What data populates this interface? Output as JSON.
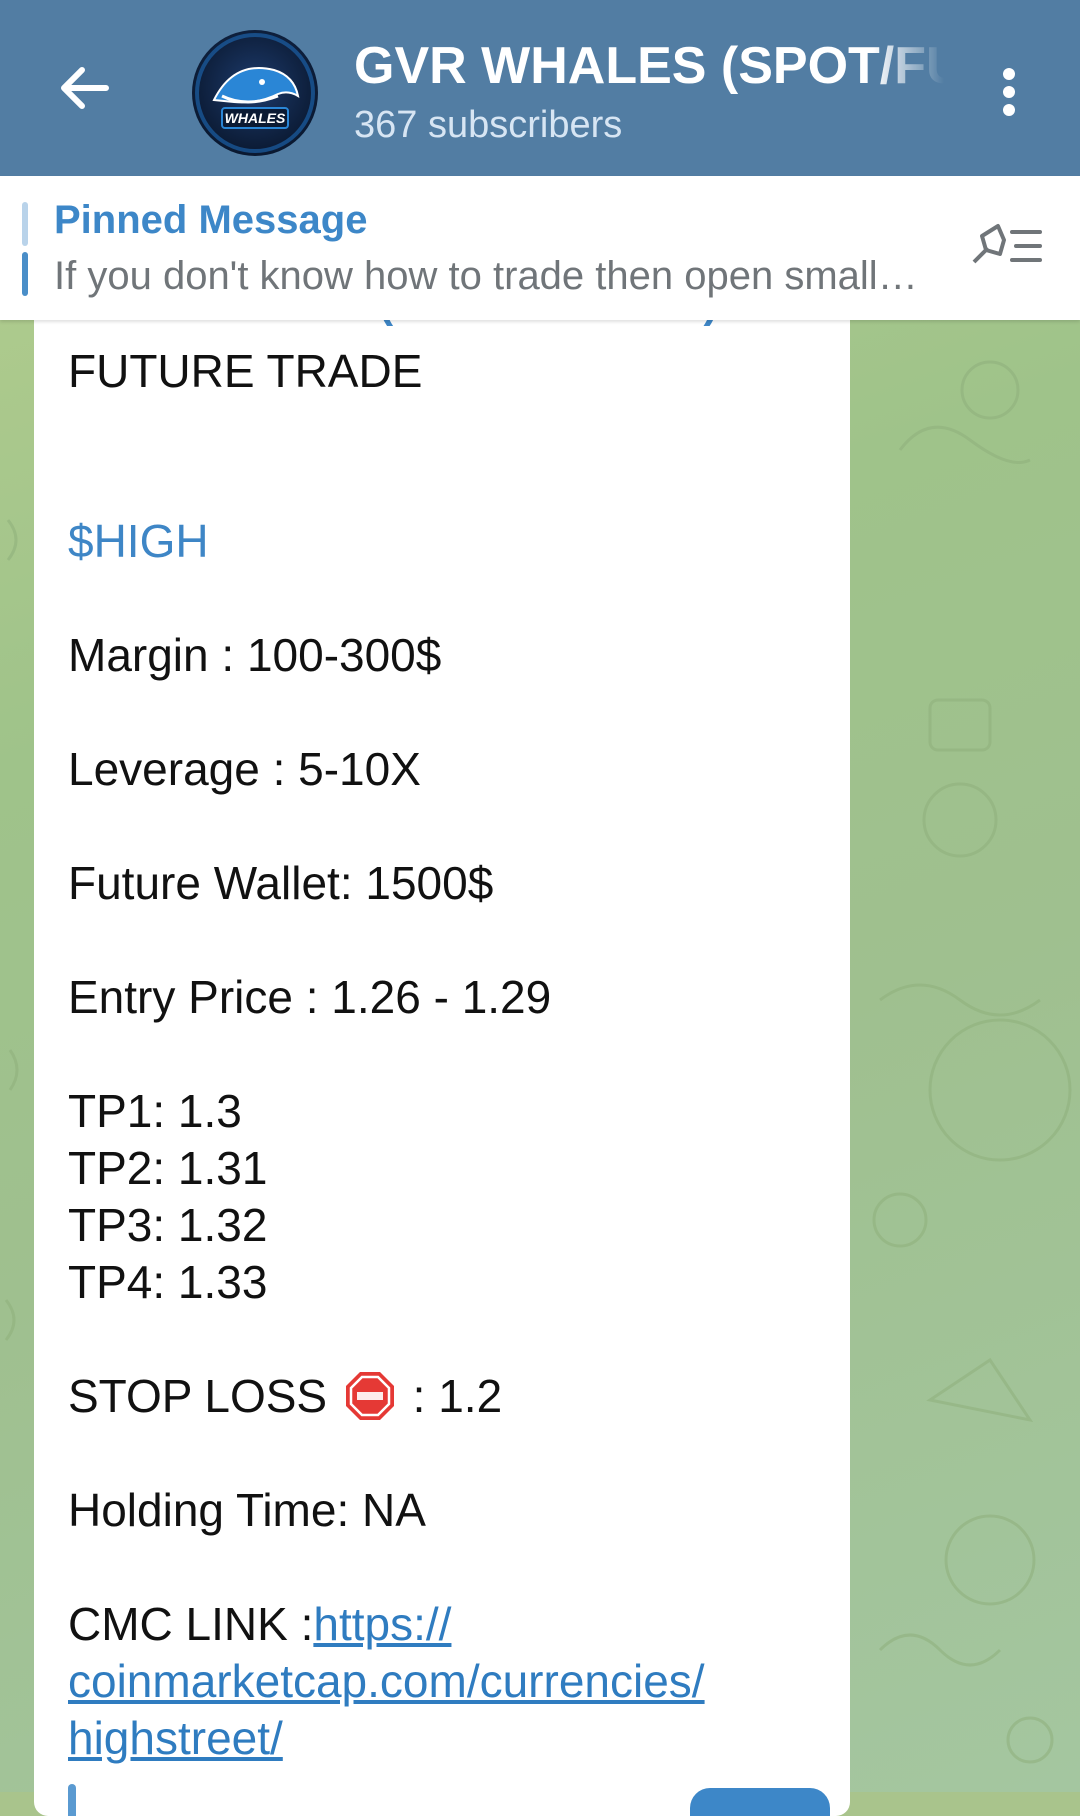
{
  "header": {
    "title": "GVR WHALES (SPOT/FUTURE)",
    "subscribers": "367 subscribers",
    "avatar_text": "WHALES"
  },
  "pinned": {
    "title": "Pinned Message",
    "text": "If you don't know how to trade then open small…"
  },
  "message": {
    "channel_sign": "GVR WHALES (SPOT/FUTURE)",
    "line_type": "FUTURE TRADE",
    "ticker": "$HIGH",
    "margin": "Margin : 100-300$",
    "leverage": "Leverage : 5-10X",
    "wallet": "Future Wallet: 1500$",
    "entry": "Entry Price : 1.26 -  1.29",
    "tp1": "TP1: 1.3",
    "tp2": "TP2: 1.31",
    "tp3": "TP3: 1.32",
    "tp4": "TP4: 1.33",
    "stop_loss_label": "STOP LOSS",
    "stop_loss_value": ": 1.2",
    "holding": "Holding Time: NA",
    "cmc_label": "CMC LINK :",
    "cmc_link_1": "https://",
    "cmc_link_2": "coinmarketcap.com/currencies/",
    "cmc_link_3": "highstreet/"
  },
  "colors": {
    "header_bg": "#527da3",
    "accent": "#3e86c6",
    "stop_red": "#e53935"
  },
  "icons": {
    "back": "arrow-left-icon",
    "menu": "more-vertical-icon",
    "pinned_list": "pin-list-icon",
    "stop": "stop-sign-icon"
  }
}
